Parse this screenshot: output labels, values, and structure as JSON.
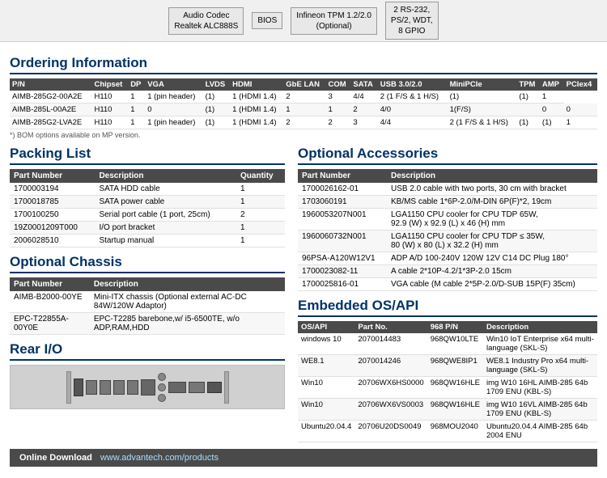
{
  "block_diagram": {
    "items": [
      {
        "label": "Audio Codec\nRealtek ALC888S"
      },
      {
        "label": "BIOS"
      },
      {
        "label": "Infineon TPM 1.2/2.0\n(Optional)"
      },
      {
        "label": "2 RS-232,\nPS/2, WDT,\n8 GPIO"
      }
    ]
  },
  "ordering": {
    "title": "Ordering Information",
    "columns": [
      "P/N",
      "Chipset",
      "DP",
      "VGA",
      "LVDS",
      "HDMI",
      "GbE LAN",
      "COM",
      "SATA",
      "USB 3.0/2.0",
      "MiniPCIe",
      "TPM",
      "AMP",
      "PCIex4"
    ],
    "rows": [
      [
        "AIMB-285G2-00A2E",
        "H110",
        "1",
        "1 (pin header)",
        "(1)",
        "1 (HDMI 1.4)",
        "2",
        "3",
        "4/4",
        "2 (1 F/S & 1 H/S)",
        "(1)",
        "(1)",
        "1"
      ],
      [
        "AIMB-285L-00A2E",
        "H110",
        "1",
        "0",
        "(1)",
        "1 (HDMI 1.4)",
        "1",
        "1",
        "2",
        "4/0",
        "1(F/S)",
        "",
        "0",
        "0"
      ],
      [
        "AIMB-285G2-LVA2E",
        "H110",
        "1",
        "1 (pin header)",
        "(1)",
        "1 (HDMI 1.4)",
        "2",
        "2",
        "3",
        "4/4",
        "2 (1 F/S & 1 H/S)",
        "(1)",
        "(1)",
        "1"
      ]
    ],
    "footnote": "*) BOM options available on MP version."
  },
  "packing_list": {
    "title": "Packing List",
    "columns": [
      "Part Number",
      "Description",
      "Quantity"
    ],
    "rows": [
      [
        "1700003194",
        "SATA HDD cable",
        "1"
      ],
      [
        "1700018785",
        "SATA power cable",
        "1"
      ],
      [
        "1700100250",
        "Serial port cable (1 port, 25cm)",
        "2"
      ],
      [
        "19Z0001209T000",
        "I/O port bracket",
        "1"
      ],
      [
        "2006028510",
        "Startup manual",
        "1"
      ]
    ]
  },
  "optional_chassis": {
    "title": "Optional Chassis",
    "columns": [
      "Part Number",
      "Description"
    ],
    "rows": [
      [
        "AIMB-B2000-00YE",
        "Mini-ITX chassis (Optional external AC-DC 84W/120W Adaptor)"
      ],
      [
        "EPC-T22855A-00Y0E",
        "EPC-T2285 barebone,w/ i5-6500TE, w/o ADP,RAM,HDD"
      ]
    ]
  },
  "rear_io": {
    "title": "Rear I/O"
  },
  "optional_accessories": {
    "title": "Optional Accessories",
    "columns": [
      "Part Number",
      "Description"
    ],
    "rows": [
      [
        "1700026162-01",
        "USB 2.0 cable with two ports, 30 cm with bracket"
      ],
      [
        "1703060191",
        "KB/MS cable 1*6P-2.0/M-DIN 6P(F)*2, 19cm"
      ],
      [
        "1960053207N001",
        "LGA1150 CPU cooler for CPU TDP 65W,\n92.9 (W) x 92.9 (L) x 46 (H) mm"
      ],
      [
        "1960060732N001",
        "LGA1150 CPU cooler for CPU TDP ≤ 35W,\n80 (W) x 80 (L) x 32.2 (H) mm"
      ],
      [
        "96PSA-A120W12V1",
        "ADP A/D 100-240V 120W 12V C14 DC Plug 180°"
      ],
      [
        "1700023082-11",
        "A cable 2*10P-4.2/1*3P-2.0 15cm"
      ],
      [
        "1700025816-01",
        "VGA cable (M cable 2*5P-2.0/D-SUB 15P(F) 35cm)"
      ]
    ]
  },
  "embedded_os": {
    "title": "Embedded OS/API",
    "columns": [
      "OS/API",
      "Part No.",
      "968 P/N",
      "Description"
    ],
    "rows": [
      [
        "windows 10",
        "2070014483",
        "968QW10LTE",
        "Win10 IoT Enterprise x64 multi-language (SKL-S)"
      ],
      [
        "WE8.1",
        "2070014246",
        "968QWE8IP1",
        "WE8.1 Industry Pro x64 multi-language (SKL-S)"
      ],
      [
        "Win10",
        "20706WX6HS0000",
        "968QW16HLE",
        "img W10 16HL AIMB-285 64b 1709 ENU (KBL-S)"
      ],
      [
        "Win10",
        "20706WX6VS0003",
        "968QW16HLE",
        "img W10 16VL AIMB-285 64b 1709 ENU (KBL-S)"
      ],
      [
        "Ubuntu20.04.4",
        "20706U20DS0049",
        "968MOU2040",
        "Ubuntu20.04.4 AIMB-285 64b 2004 ENU"
      ]
    ]
  },
  "bottom_bar": {
    "label": "Online Download",
    "url": "www.advantech.com/products"
  }
}
